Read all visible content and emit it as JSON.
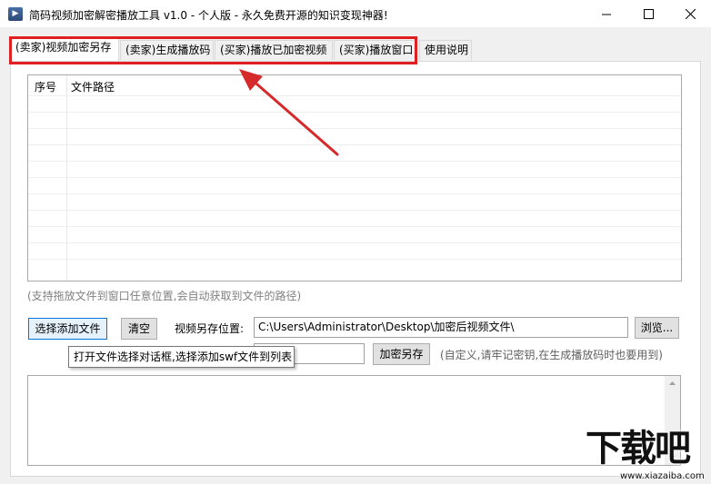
{
  "window": {
    "title": "简码视频加密解密播放工具 v1.0 - 个人版 - 永久免费开源的知识变现神器!",
    "icon": "app-icon"
  },
  "tabs": [
    {
      "label": "(卖家)视频加密另存",
      "active": true
    },
    {
      "label": "(卖家)生成播放码",
      "active": false
    },
    {
      "label": "(买家)播放已加密视频",
      "active": false
    },
    {
      "label": "(买家)播放窗口",
      "active": false
    },
    {
      "label": "使用说明",
      "active": false
    }
  ],
  "file_list": {
    "columns": [
      "序号",
      "文件路径"
    ],
    "rows": []
  },
  "drag_hint": "(支持拖放文件到窗口任意位置,会自动获取到文件的路径)",
  "buttons": {
    "add_file": "选择添加文件",
    "clear": "清空",
    "browse": "浏览...",
    "encrypt_save": "加密另存"
  },
  "save_location": {
    "label": "视频另存位置:",
    "value": "C:\\Users\\Administrator\\Desktop\\加密后视频文件\\"
  },
  "password_hint": "(自定义,请牢记密钥,在生成播放码时也要用到)",
  "tooltip": "打开文件选择对话框,选择添加swf文件到列表",
  "watermark": {
    "logo": "下载吧",
    "url": "www.xiazaiba.com"
  },
  "colors": {
    "highlight": "#e02020",
    "arrow": "#d62a2a",
    "focus_border": "#0078d7"
  }
}
